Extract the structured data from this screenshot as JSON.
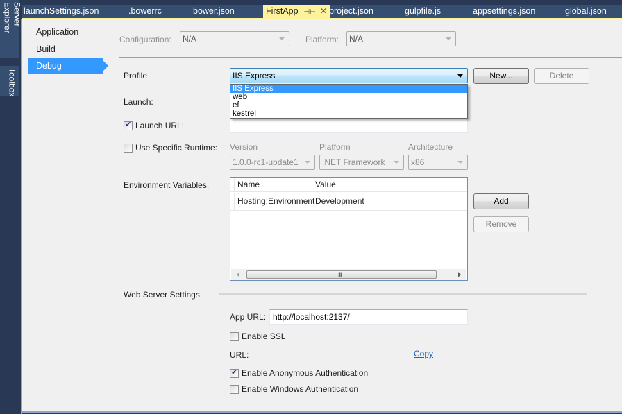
{
  "dock": {
    "server_explorer": "Server Explorer",
    "toolbox": "Toolbox"
  },
  "tabs": [
    {
      "label": "launchSettings.json",
      "active": false
    },
    {
      "label": ".bowerrc",
      "active": false
    },
    {
      "label": "bower.json",
      "active": false
    },
    {
      "label": "FirstApp",
      "active": true
    },
    {
      "label": "project.json",
      "active": false
    },
    {
      "label": "gulpfile.js",
      "active": false
    },
    {
      "label": "appsettings.json",
      "active": false
    },
    {
      "label": "global.json",
      "active": false
    }
  ],
  "tab_icons": {
    "pin": "⊣⊢",
    "close": "✕"
  },
  "nav": {
    "items": [
      {
        "label": "Application",
        "active": false
      },
      {
        "label": "Build",
        "active": false
      },
      {
        "label": "Debug",
        "active": true
      }
    ]
  },
  "config": {
    "configuration_label": "Configuration:",
    "configuration_value": "N/A",
    "platform_label": "Platform:",
    "platform_value": "N/A"
  },
  "profile": {
    "label": "Profile",
    "selected": "IIS Express",
    "options": [
      "IIS Express",
      "web",
      "ef",
      "kestrel"
    ],
    "new_button": "New...",
    "delete_button": "Delete"
  },
  "launch": {
    "label": "Launch:",
    "launch_url_label": "Launch URL:",
    "launch_url_checked": true,
    "launch_url_value": ""
  },
  "runtime": {
    "label": "Use Specific Runtime:",
    "checked": false,
    "version_label": "Version",
    "version_value": "1.0.0-rc1-update1",
    "platform_label": "Platform",
    "platform_value": ".NET Framework",
    "architecture_label": "Architecture",
    "architecture_value": "x86"
  },
  "env": {
    "label": "Environment Variables:",
    "columns": [
      "Name",
      "Value"
    ],
    "rows": [
      {
        "name": "Hosting:Environment",
        "value": "Development"
      }
    ],
    "add_button": "Add",
    "remove_button": "Remove",
    "scroll_grip": "III"
  },
  "web_server": {
    "section_label": "Web Server Settings",
    "app_url_label": "App URL:",
    "app_url_value": "http://localhost:2137/",
    "enable_ssl_label": "Enable SSL",
    "enable_ssl_checked": false,
    "url_label": "URL:",
    "copy_link": "Copy",
    "anon_auth_label": "Enable Anonymous Authentication",
    "anon_auth_checked": true,
    "windows_auth_label": "Enable Windows Authentication",
    "windows_auth_checked": false
  },
  "colors": {
    "accent": "#3399ff",
    "tab_active": "#fff29d",
    "chrome": "#293955",
    "link": "#1c64b4"
  }
}
